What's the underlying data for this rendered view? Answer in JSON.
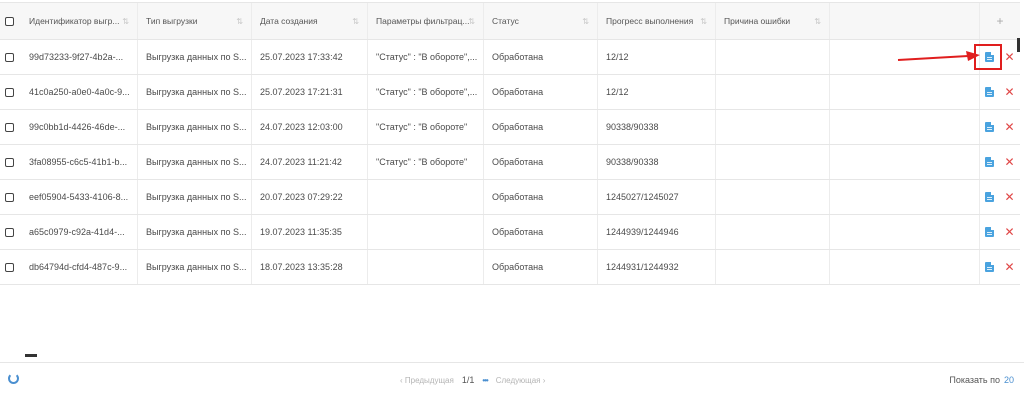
{
  "columns": {
    "id": "Идентификатор выгр...",
    "type": "Тип выгрузки",
    "date": "Дата создания",
    "params": "Параметры фильтрац...",
    "status": "Статус",
    "progress": "Прогресс выполнения",
    "error": "Причина ошибки",
    "add": "+"
  },
  "rows": [
    {
      "id": "99d73233-9f27-4b2a-...",
      "type": "Выгрузка данных по S...",
      "date": "25.07.2023 17:33:42",
      "params": "\"Статус\" : \"В обороте\",...",
      "status": "Обработана",
      "progress": "12/12",
      "error": ""
    },
    {
      "id": "41c0a250-a0e0-4a0c-9...",
      "type": "Выгрузка данных по S...",
      "date": "25.07.2023 17:21:31",
      "params": "\"Статус\" : \"В обороте\",...",
      "status": "Обработана",
      "progress": "12/12",
      "error": ""
    },
    {
      "id": "99c0bb1d-4426-46de-...",
      "type": "Выгрузка данных по S...",
      "date": "24.07.2023 12:03:00",
      "params": "\"Статус\" : \"В обороте\"",
      "status": "Обработана",
      "progress": "90338/90338",
      "error": ""
    },
    {
      "id": "3fa08955-c6c5-41b1-b...",
      "type": "Выгрузка данных по S...",
      "date": "24.07.2023 11:21:42",
      "params": "\"Статус\" : \"В обороте\"",
      "status": "Обработана",
      "progress": "90338/90338",
      "error": ""
    },
    {
      "id": "eef05904-5433-4106-8...",
      "type": "Выгрузка данных по S...",
      "date": "20.07.2023 07:29:22",
      "params": "",
      "status": "Обработана",
      "progress": "1245027/1245027",
      "error": ""
    },
    {
      "id": "a65c0979-c92a-41d4-...",
      "type": "Выгрузка данных по S...",
      "date": "19.07.2023 11:35:35",
      "params": "",
      "status": "Обработана",
      "progress": "1244939/1244946",
      "error": ""
    },
    {
      "id": "db64794d-cfd4-487c-9...",
      "type": "Выгрузка данных по S...",
      "date": "18.07.2023 13:35:28",
      "params": "",
      "status": "Обработана",
      "progress": "1244931/1244932",
      "error": ""
    }
  ],
  "icons": {
    "download": "document-icon",
    "delete": "close-icon",
    "sort": "sort-icon",
    "refresh": "refresh-icon"
  },
  "colors": {
    "accent": "#4a8fd0",
    "delete": "#e04646",
    "highlight": "#e01e1e"
  },
  "pagination": {
    "prev": "‹  Предыдущая",
    "page": "1/1",
    "more": "•••",
    "next": "Следующая  ›"
  },
  "page_size": {
    "label": "Показать по",
    "value": "20"
  }
}
